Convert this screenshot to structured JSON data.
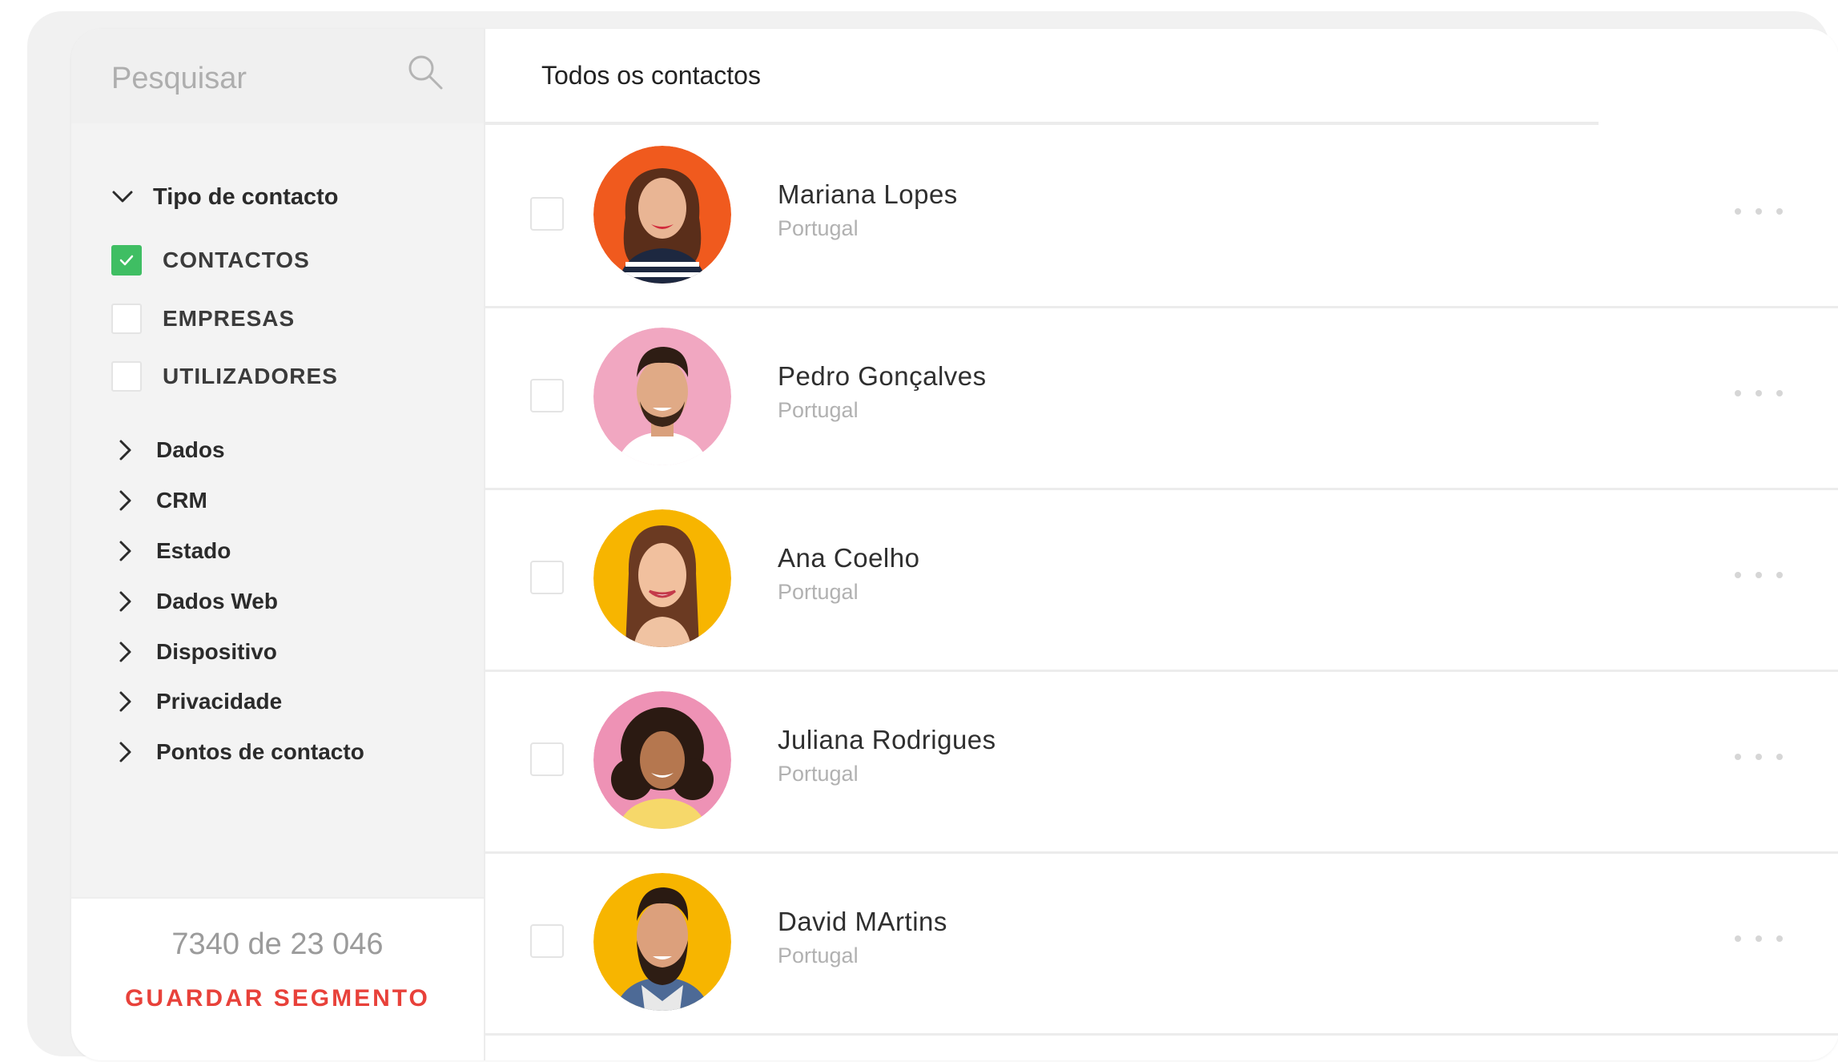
{
  "search": {
    "placeholder": "Pesquisar",
    "icon": "search-icon"
  },
  "filters": {
    "section_title": "Tipo de contacto",
    "checkboxes": [
      {
        "label": "CONTACTOS",
        "checked": true
      },
      {
        "label": "EMPRESAS",
        "checked": false
      },
      {
        "label": "UTILIZADORES",
        "checked": false
      }
    ],
    "categories": [
      {
        "label": "Dados"
      },
      {
        "label": "CRM"
      },
      {
        "label": "Estado"
      },
      {
        "label": "Dados Web"
      },
      {
        "label": "Dispositivo"
      },
      {
        "label": "Privacidade"
      },
      {
        "label": "Pontos de contacto"
      }
    ]
  },
  "footer": {
    "count_text": "7340 de 23 046",
    "save_label": "GUARDAR SEGMENTO"
  },
  "main": {
    "title": "Todos os contactos",
    "contacts": [
      {
        "name": "Mariana Lopes",
        "country": "Portugal",
        "avatar_bg": "#f05a1e"
      },
      {
        "name": "Pedro Gonçalves",
        "country": "Portugal",
        "avatar_bg": "#f1a7c1"
      },
      {
        "name": "Ana Coelho",
        "country": "Portugal",
        "avatar_bg": "#f7b500"
      },
      {
        "name": "Juliana Rodrigues",
        "country": "Portugal",
        "avatar_bg": "#ee92b5"
      },
      {
        "name": "David MArtins",
        "country": "Portugal",
        "avatar_bg": "#f7b500"
      }
    ]
  },
  "colors": {
    "accent_green": "#3fbe63",
    "accent_red": "#e8413a"
  }
}
